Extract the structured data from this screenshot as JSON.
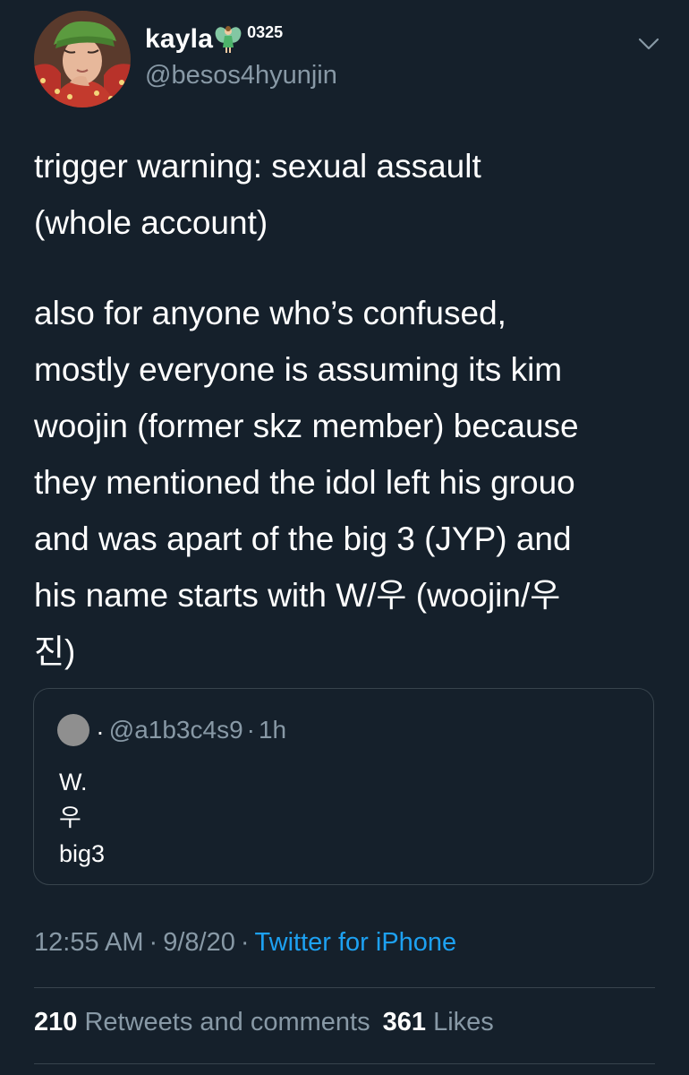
{
  "author": {
    "display_name": "kayla",
    "name_suffix": "0325",
    "handle": "@besos4hyunjin"
  },
  "tweet": {
    "paragraph_1": "trigger warning: sexual assault\n(whole account)",
    "paragraph_2": "also for anyone who’s confused,\nmostly everyone is assuming its kim\nwoojin (former skz member) because\nthey mentioned the idol left his grouo\nand was apart of the big 3 (JYP) and\nhis name starts with W/우 (woojin/우\n진)"
  },
  "quoted_tweet": {
    "dot": ".",
    "handle": "@a1b3c4s9",
    "separator": "·",
    "time": "1h",
    "lines": [
      "W.",
      "우",
      "big3"
    ]
  },
  "meta": {
    "time": "12:55 AM",
    "separator": "·",
    "date": "9/8/20",
    "source": "Twitter for iPhone"
  },
  "stats": {
    "retweets_count": "210",
    "retweets_label": "Retweets and comments",
    "likes_count": "361",
    "likes_label": "Likes"
  },
  "icons": {
    "avatar": "profile-photo",
    "name_emoji": "fairy-icon",
    "menu": "chevron-down-icon"
  },
  "colors": {
    "background": "#15202b",
    "text": "#ffffff",
    "secondary_text": "#8899a6",
    "link": "#1da1f2",
    "border": "#38444d"
  }
}
